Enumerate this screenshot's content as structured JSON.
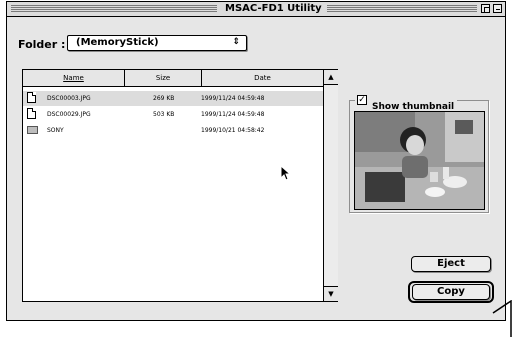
{
  "window": {
    "title": "MSAC-FD1 Utility"
  },
  "folder": {
    "label": "Folder :",
    "value": "(MemoryStick)",
    "arrows": "⇕"
  },
  "list": {
    "columns": [
      "Name",
      "Size",
      "Date"
    ],
    "rows": [
      {
        "type": "file",
        "name": "DSC00003.JPG",
        "size": "269 KB",
        "date": "1999/11/24 04:59:48",
        "selected": true
      },
      {
        "type": "file",
        "name": "DSC00029.JPG",
        "size": "503 KB",
        "date": "1999/11/24 04:59:48",
        "selected": false
      },
      {
        "type": "folder",
        "name": "SONY",
        "size": "",
        "date": "1999/10/21 04:58:42",
        "selected": false
      }
    ],
    "scroll_up": "▲",
    "scroll_down": "▼"
  },
  "thumbnail": {
    "label": "Show thumbnail",
    "checked": true,
    "check_mark": "✓"
  },
  "buttons": {
    "eject": "Eject",
    "copy": "Copy"
  }
}
